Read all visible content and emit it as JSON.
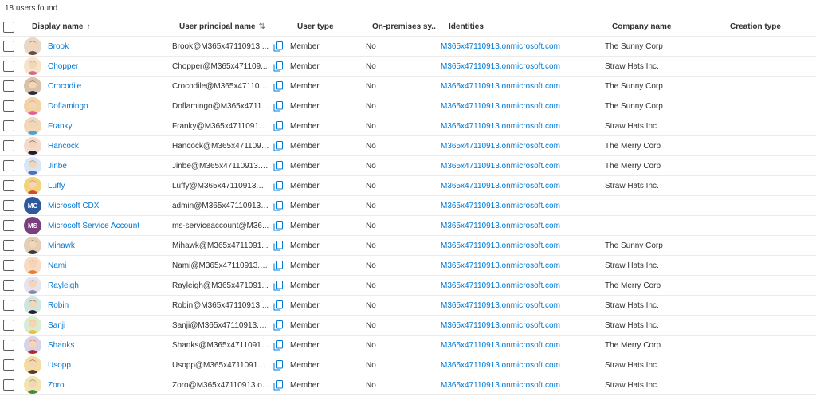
{
  "summary": {
    "count_text": "18 users found"
  },
  "columns": {
    "display_name": "Display name",
    "display_name_sort": "↑",
    "upn": "User principal name",
    "upn_sort": "⇅",
    "user_type": "User type",
    "on_premises": "On-premises sy...",
    "identities": "Identities",
    "company": "Company name",
    "creation_type": "Creation type"
  },
  "users": [
    {
      "name": "Brook",
      "upn": "Brook@M365x47110913....",
      "type": "Member",
      "onprem": "No",
      "identity": "M365x47110913.onmicrosoft.com",
      "company": "The Sunny Corp",
      "avatar_initials": "",
      "avatar_color": "#6b4a3a",
      "avatar_bg": "#e9d7c8"
    },
    {
      "name": "Chopper",
      "upn": "Chopper@M365x471109...",
      "type": "Member",
      "onprem": "No",
      "identity": "M365x47110913.onmicrosoft.com",
      "company": "Straw Hats Inc.",
      "avatar_initials": "",
      "avatar_color": "#d46b8a",
      "avatar_bg": "#f6e3c9"
    },
    {
      "name": "Crocodile",
      "upn": "Crocodile@M365x471109...",
      "type": "Member",
      "onprem": "No",
      "identity": "M365x47110913.onmicrosoft.com",
      "company": "The Sunny Corp",
      "avatar_initials": "",
      "avatar_color": "#2b2b3a",
      "avatar_bg": "#d9c3a8"
    },
    {
      "name": "Doflamingo",
      "upn": "Doflamingo@M365x4711...",
      "type": "Member",
      "onprem": "No",
      "identity": "M365x47110913.onmicrosoft.com",
      "company": "The Sunny Corp",
      "avatar_initials": "",
      "avatar_color": "#e0609a",
      "avatar_bg": "#f3d2a3"
    },
    {
      "name": "Franky",
      "upn": "Franky@M365x47110913....",
      "type": "Member",
      "onprem": "No",
      "identity": "M365x47110913.onmicrosoft.com",
      "company": "Straw Hats Inc.",
      "avatar_initials": "",
      "avatar_color": "#4aa3d8",
      "avatar_bg": "#f1d8b8"
    },
    {
      "name": "Hancock",
      "upn": "Hancock@M365x4711091...",
      "type": "Member",
      "onprem": "No",
      "identity": "M365x47110913.onmicrosoft.com",
      "company": "The Merry Corp",
      "avatar_initials": "",
      "avatar_color": "#1e1e2a",
      "avatar_bg": "#f4d9cf"
    },
    {
      "name": "Jinbe",
      "upn": "Jinbe@M365x47110913.o...",
      "type": "Member",
      "onprem": "No",
      "identity": "M365x47110913.onmicrosoft.com",
      "company": "The Merry Corp",
      "avatar_initials": "",
      "avatar_color": "#4d6fbf",
      "avatar_bg": "#d7e6f5"
    },
    {
      "name": "Luffy",
      "upn": "Luffy@M365x47110913.o...",
      "type": "Member",
      "onprem": "No",
      "identity": "M365x47110913.onmicrosoft.com",
      "company": "Straw Hats Inc.",
      "avatar_initials": "",
      "avatar_color": "#d94a2a",
      "avatar_bg": "#f2d37a"
    },
    {
      "name": "Microsoft CDX",
      "upn": "admin@M365x47110913....",
      "type": "Member",
      "onprem": "No",
      "identity": "M365x47110913.onmicrosoft.com",
      "company": "",
      "avatar_initials": "MC",
      "avatar_color": "#ffffff",
      "avatar_bg": "#2e5a9c"
    },
    {
      "name": "Microsoft Service Account",
      "upn": "ms-serviceaccount@M36...",
      "type": "Member",
      "onprem": "No",
      "identity": "M365x47110913.onmicrosoft.com",
      "company": "",
      "avatar_initials": "MS",
      "avatar_color": "#ffffff",
      "avatar_bg": "#7a3f7e"
    },
    {
      "name": "Mihawk",
      "upn": "Mihawk@M365x4711091...",
      "type": "Member",
      "onprem": "No",
      "identity": "M365x47110913.onmicrosoft.com",
      "company": "The Sunny Corp",
      "avatar_initials": "",
      "avatar_color": "#3a3a3a",
      "avatar_bg": "#e4cfb6"
    },
    {
      "name": "Nami",
      "upn": "Nami@M365x47110913.o...",
      "type": "Member",
      "onprem": "No",
      "identity": "M365x47110913.onmicrosoft.com",
      "company": "Straw Hats Inc.",
      "avatar_initials": "",
      "avatar_color": "#ef7d2e",
      "avatar_bg": "#f8dbc2"
    },
    {
      "name": "Rayleigh",
      "upn": "Rayleigh@M365x471091...",
      "type": "Member",
      "onprem": "No",
      "identity": "M365x47110913.onmicrosoft.com",
      "company": "The Merry Corp",
      "avatar_initials": "",
      "avatar_color": "#8a8aa8",
      "avatar_bg": "#e8e2ee"
    },
    {
      "name": "Robin",
      "upn": "Robin@M365x47110913....",
      "type": "Member",
      "onprem": "No",
      "identity": "M365x47110913.onmicrosoft.com",
      "company": "Straw Hats Inc.",
      "avatar_initials": "",
      "avatar_color": "#222233",
      "avatar_bg": "#cfe6e0"
    },
    {
      "name": "Sanji",
      "upn": "Sanji@M365x47110913.o...",
      "type": "Member",
      "onprem": "No",
      "identity": "M365x47110913.onmicrosoft.com",
      "company": "Straw Hats Inc.",
      "avatar_initials": "",
      "avatar_color": "#e8c23a",
      "avatar_bg": "#d8ecd2"
    },
    {
      "name": "Shanks",
      "upn": "Shanks@M365x47110913...",
      "type": "Member",
      "onprem": "No",
      "identity": "M365x47110913.onmicrosoft.com",
      "company": "The Merry Corp",
      "avatar_initials": "",
      "avatar_color": "#b32a2a",
      "avatar_bg": "#d8d2e8"
    },
    {
      "name": "Usopp",
      "upn": "Usopp@M365x47110913....",
      "type": "Member",
      "onprem": "No",
      "identity": "M365x47110913.onmicrosoft.com",
      "company": "Straw Hats Inc.",
      "avatar_initials": "",
      "avatar_color": "#5a3a22",
      "avatar_bg": "#f3dca0"
    },
    {
      "name": "Zoro",
      "upn": "Zoro@M365x47110913.o...",
      "type": "Member",
      "onprem": "No",
      "identity": "M365x47110913.onmicrosoft.com",
      "company": "Straw Hats Inc.",
      "avatar_initials": "",
      "avatar_color": "#3f8a3f",
      "avatar_bg": "#f2e3b0"
    }
  ]
}
